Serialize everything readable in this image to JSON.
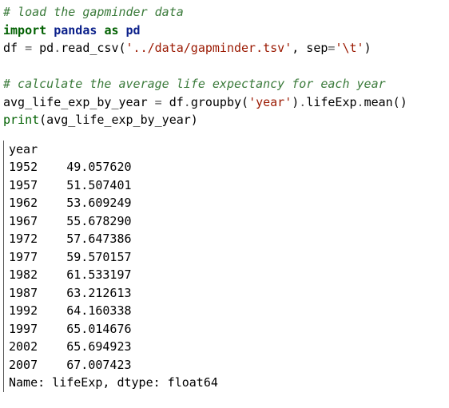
{
  "code": {
    "comment1": "# load the gapminder data",
    "kw_import": "import",
    "mod_pandas": "pandas",
    "kw_as": "as",
    "mod_pd": "pd",
    "line2_a": "df ",
    "line2_eq": "=",
    "line2_b": " pd",
    "line2_dot1": ".",
    "line2_c": "read_csv(",
    "line2_str1": "'../data/gapminder.tsv'",
    "line2_d": ", sep",
    "line2_eq2": "=",
    "line2_str2": "'\\t'",
    "line2_e": ")",
    "blank": " ",
    "comment2": "# calculate the average life expectancy for each year",
    "line4_a": "avg_life_exp_by_year ",
    "line4_eq": "=",
    "line4_b": " df",
    "line4_dot1": ".",
    "line4_c": "groupby(",
    "line4_str": "'year'",
    "line4_d": ")",
    "line4_dot2": ".",
    "line4_e": "lifeExp",
    "line4_dot3": ".",
    "line4_f": "mean()",
    "line5_print": "print",
    "line5_rest": "(avg_life_exp_by_year)"
  },
  "output": {
    "header": "year",
    "rows": [
      "1952    49.057620",
      "1957    51.507401",
      "1962    53.609249",
      "1967    55.678290",
      "1972    57.647386",
      "1977    59.570157",
      "1982    61.533197",
      "1987    63.212613",
      "1992    64.160338",
      "1997    65.014676",
      "2002    65.694923",
      "2007    67.007423"
    ],
    "footer": "Name: lifeExp, dtype: float64"
  }
}
